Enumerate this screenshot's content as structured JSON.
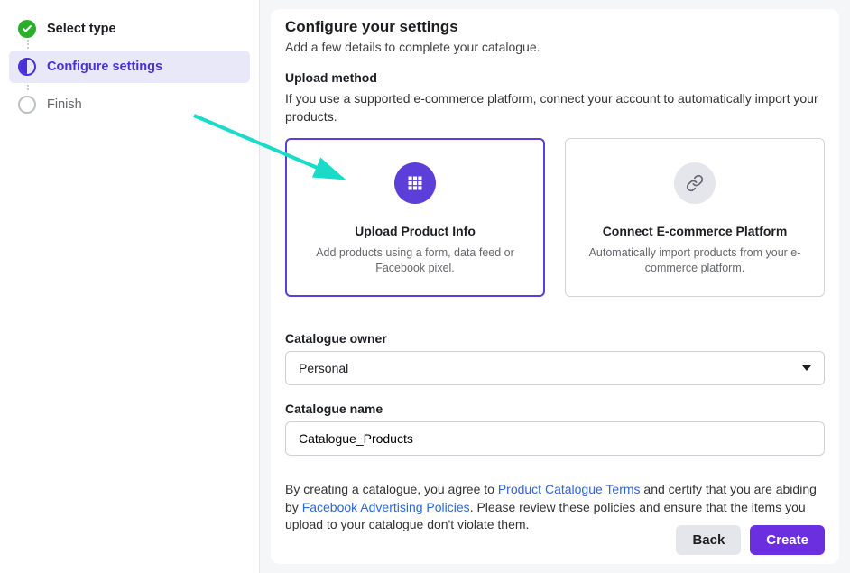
{
  "sidebar": {
    "steps": [
      {
        "label": "Select type"
      },
      {
        "label": "Configure settings"
      },
      {
        "label": "Finish"
      }
    ]
  },
  "main": {
    "title": "Configure your settings",
    "subtitle": "Add a few details to complete your catalogue.",
    "upload": {
      "label": "Upload method",
      "desc": "If you use a supported e-commerce platform, connect your account to automatically import your products.",
      "options": [
        {
          "title": "Upload Product Info",
          "desc": "Add products using a form, data feed or Facebook pixel."
        },
        {
          "title": "Connect E-commerce Platform",
          "desc": "Automatically import products from your e-commerce platform."
        }
      ]
    },
    "owner": {
      "label": "Catalogue owner",
      "value": "Personal"
    },
    "name": {
      "label": "Catalogue name",
      "value": "Catalogue_Products"
    },
    "legal": {
      "t1": "By creating a catalogue, you agree to ",
      "link1": "Product Catalogue Terms",
      "t2": " and certify that you are abiding by ",
      "link2": "Facebook Advertising Policies",
      "t3": ". Please review these policies and ensure that the items you upload to your catalogue don't violate them."
    },
    "buttons": {
      "back": "Back",
      "create": "Create"
    }
  }
}
